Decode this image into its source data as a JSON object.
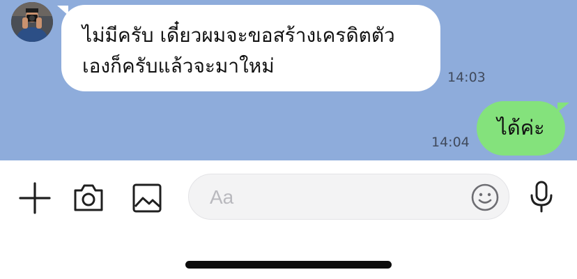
{
  "chat": {
    "background_color": "#8eacdb",
    "messages": [
      {
        "direction": "incoming",
        "text": "ไม่มีครับ เดี๋ยวผมจะขอสร้างเครดิตตัว\nเองก็ครับแล้วจะมาใหม่",
        "time": "14:03",
        "bubble_color": "#ffffff"
      },
      {
        "direction": "outgoing",
        "text": "ได้ค่ะ",
        "time": "14:04",
        "bubble_color": "#84e27c"
      }
    ]
  },
  "toolbar": {
    "icons": [
      "plus-icon",
      "camera-icon",
      "image-icon",
      "emoji-icon",
      "microphone-icon"
    ],
    "input_placeholder": "Aa"
  }
}
